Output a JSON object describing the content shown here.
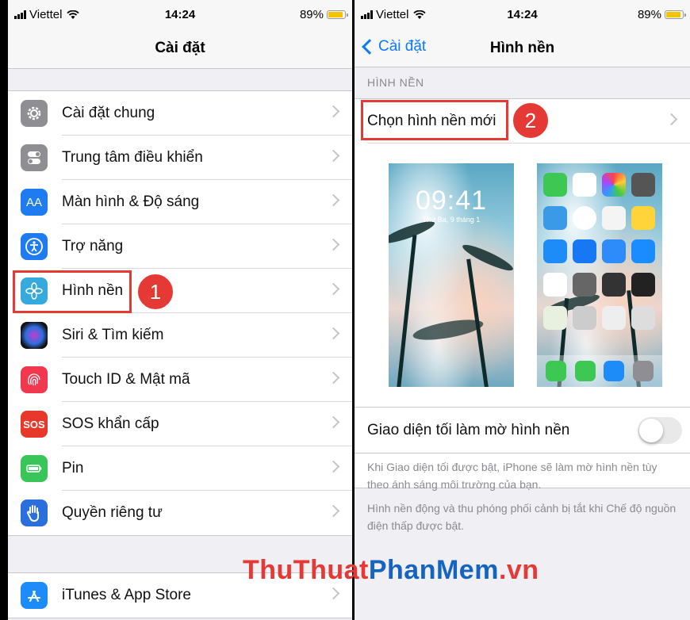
{
  "status": {
    "carrier": "Viettel",
    "time": "14:24",
    "battery": "89%",
    "battery_level": 0.89
  },
  "left": {
    "title": "Cài đặt",
    "items": [
      {
        "label": "Cài đặt chung",
        "icon": "gear-icon",
        "color": "#8e8e93"
      },
      {
        "label": "Trung tâm điều khiển",
        "icon": "toggles-icon",
        "color": "#8e8e93"
      },
      {
        "label": "Màn hình & Độ sáng",
        "icon": "text-size-icon",
        "icon_text": "AA",
        "color": "#1f7cf0"
      },
      {
        "label": "Trợ năng",
        "icon": "accessibility-icon",
        "color": "#1f7cf0"
      },
      {
        "label": "Hình nền",
        "icon": "flower-icon",
        "color": "#36aadc"
      },
      {
        "label": "Siri & Tìm kiếm",
        "icon": "siri-icon",
        "color": "#222222"
      },
      {
        "label": "Touch ID & Mật mã",
        "icon": "fingerprint-icon",
        "color": "#f2384e"
      },
      {
        "label": "SOS khẩn cấp",
        "icon": "sos-icon",
        "icon_text": "SOS",
        "color": "#e8382c"
      },
      {
        "label": "Pin",
        "icon": "battery-icon",
        "color": "#39c559"
      },
      {
        "label": "Quyền riêng tư",
        "icon": "hand-icon",
        "color": "#2a6fdb"
      }
    ],
    "store_item": {
      "label": "iTunes & App Store",
      "icon": "app-store-icon",
      "color": "#1d8cf8"
    },
    "step_badge": "1"
  },
  "right": {
    "back_label": "Cài đặt",
    "title": "Hình nền",
    "section_header": "HÌNH NỀN",
    "choose_label": "Chọn hình nền mới",
    "step_badge": "2",
    "lock_time": "09:41",
    "lock_date": "Thứ Ba, 9 tháng 1",
    "dark_label": "Giao diện tối làm mờ hình nền",
    "dark_on": false,
    "note1": "Khi Giao diện tối được bật, iPhone sẽ làm mờ hình nền tùy theo ánh sáng môi trường của bạn.",
    "note2": "Hình nền động và thu phóng phối cảnh bị tắt khi Chế độ nguồn điện thấp được bật."
  },
  "watermark": {
    "part1": "ThuThuat",
    "part2": "PhanMem",
    "part3": ".vn"
  },
  "colors": {
    "accent": "#0a7aff",
    "highlight": "#e53935"
  }
}
